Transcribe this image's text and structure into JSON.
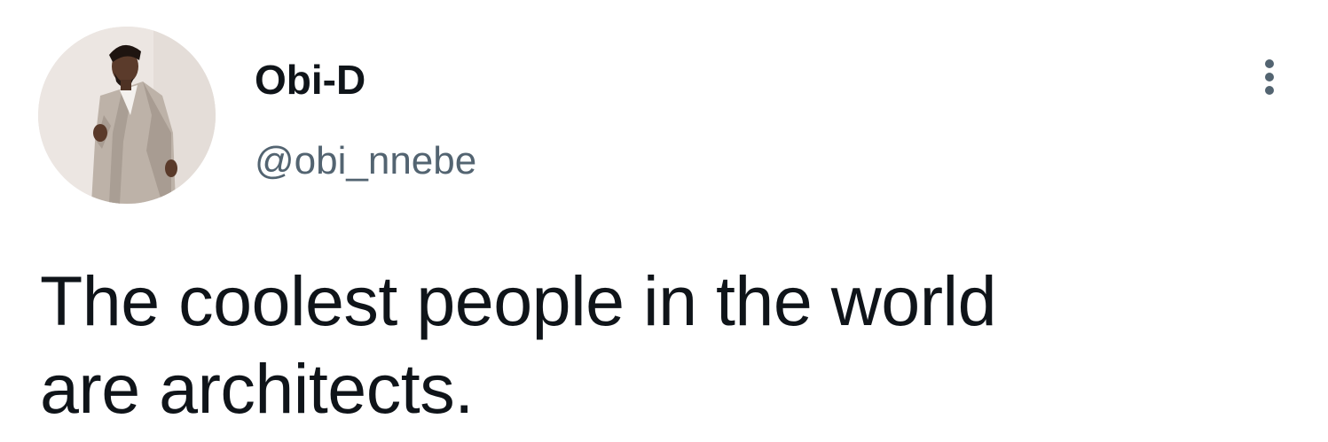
{
  "author": {
    "display_name": "Obi-D",
    "handle": "@obi_nnebe",
    "avatar_description_icon": "profile-photo"
  },
  "tweet": {
    "text": "The coolest people in the world\nare architects."
  },
  "actions": {
    "more_icon": "more-vertical-icon"
  },
  "colors": {
    "text_primary": "#0f1419",
    "text_secondary": "#536471",
    "background": "#ffffff"
  }
}
